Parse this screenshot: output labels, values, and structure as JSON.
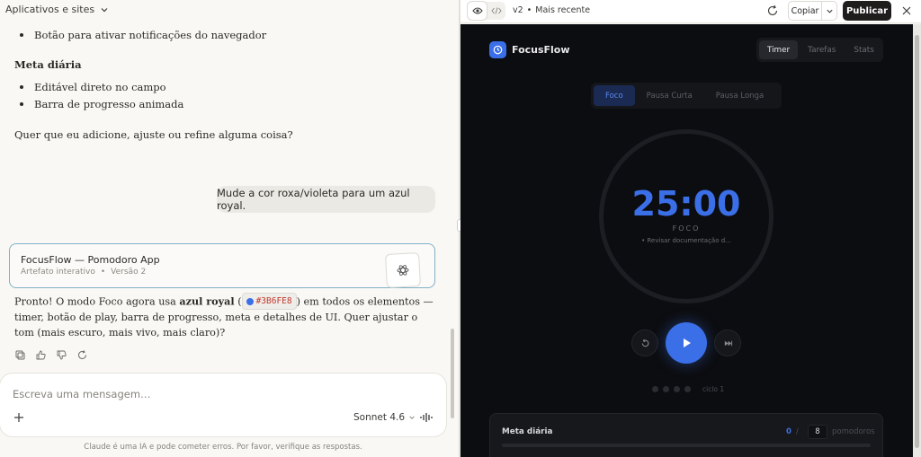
{
  "chat": {
    "topbar_label": "Aplicativos e sites",
    "bullet_notif": "Botão para ativar notificações do navegador",
    "meta_heading": "Meta diária",
    "bullet_edit": "Editável direto no campo",
    "bullet_progress": "Barra de progresso animada",
    "question": "Quer que eu adicione, ajuste ou refine alguma coisa?",
    "user_message": "Mude a cor roxa/violeta para um azul royal.",
    "artifact": {
      "title": "FocusFlow — Pomodoro App",
      "type": "Artefato interativo",
      "version": "Versão 2"
    },
    "reply": {
      "part1": "Pronto! O modo Foco agora usa ",
      "bold": "azul royal",
      "part2": " (",
      "code": "#3B6FE8",
      "part3": ") em todos os elementos — timer, botão de play, barra de progresso, meta e detalhes de UI. Quer ajustar o tom (mais escuro, mais vivo, mais claro)?"
    },
    "composer_placeholder": "Escreva uma mensagem…",
    "model": "Sonnet 4.6",
    "disclaimer": "Claude é uma IA e pode cometer erros. Por favor, verifique as respostas."
  },
  "preview": {
    "version": "v2",
    "version_status": "Mais recente",
    "copy_label": "Copiar",
    "publish_label": "Publicar"
  },
  "app": {
    "brand": "FocusFlow",
    "nav": [
      "Timer",
      "Tarefas",
      "Stats"
    ],
    "modes": [
      "Foco",
      "Pausa Curta",
      "Pausa Longa"
    ],
    "timer": "25:00",
    "phase": "FOCO",
    "task": "• Revisar documentação d...",
    "cycle": "ciclo 1",
    "goal": {
      "title": "Meta diária",
      "current": "0",
      "separator": "/",
      "target": "8",
      "unit": "pomodoros",
      "progress_fraction": 0
    },
    "accent": "#3B6FE8"
  }
}
